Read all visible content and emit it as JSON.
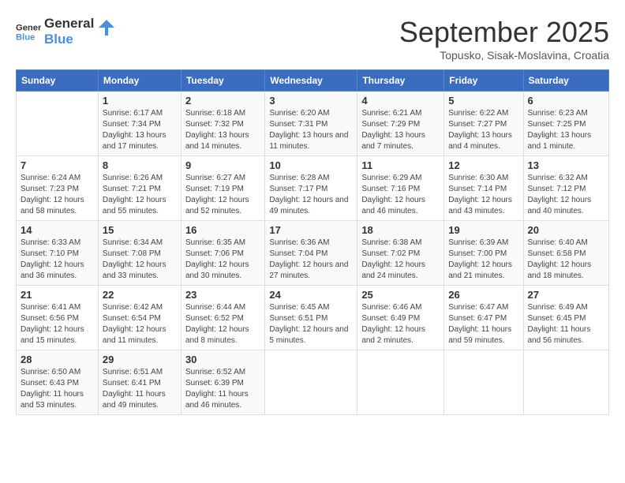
{
  "header": {
    "logo_line1": "General",
    "logo_line2": "Blue",
    "month_title": "September 2025",
    "subtitle": "Topusko, Sisak-Moslavina, Croatia"
  },
  "weekdays": [
    "Sunday",
    "Monday",
    "Tuesday",
    "Wednesday",
    "Thursday",
    "Friday",
    "Saturday"
  ],
  "weeks": [
    [
      {
        "day": "",
        "sunrise": "",
        "sunset": "",
        "daylight": ""
      },
      {
        "day": "1",
        "sunrise": "Sunrise: 6:17 AM",
        "sunset": "Sunset: 7:34 PM",
        "daylight": "Daylight: 13 hours and 17 minutes."
      },
      {
        "day": "2",
        "sunrise": "Sunrise: 6:18 AM",
        "sunset": "Sunset: 7:32 PM",
        "daylight": "Daylight: 13 hours and 14 minutes."
      },
      {
        "day": "3",
        "sunrise": "Sunrise: 6:20 AM",
        "sunset": "Sunset: 7:31 PM",
        "daylight": "Daylight: 13 hours and 11 minutes."
      },
      {
        "day": "4",
        "sunrise": "Sunrise: 6:21 AM",
        "sunset": "Sunset: 7:29 PM",
        "daylight": "Daylight: 13 hours and 7 minutes."
      },
      {
        "day": "5",
        "sunrise": "Sunrise: 6:22 AM",
        "sunset": "Sunset: 7:27 PM",
        "daylight": "Daylight: 13 hours and 4 minutes."
      },
      {
        "day": "6",
        "sunrise": "Sunrise: 6:23 AM",
        "sunset": "Sunset: 7:25 PM",
        "daylight": "Daylight: 13 hours and 1 minute."
      }
    ],
    [
      {
        "day": "7",
        "sunrise": "Sunrise: 6:24 AM",
        "sunset": "Sunset: 7:23 PM",
        "daylight": "Daylight: 12 hours and 58 minutes."
      },
      {
        "day": "8",
        "sunrise": "Sunrise: 6:26 AM",
        "sunset": "Sunset: 7:21 PM",
        "daylight": "Daylight: 12 hours and 55 minutes."
      },
      {
        "day": "9",
        "sunrise": "Sunrise: 6:27 AM",
        "sunset": "Sunset: 7:19 PM",
        "daylight": "Daylight: 12 hours and 52 minutes."
      },
      {
        "day": "10",
        "sunrise": "Sunrise: 6:28 AM",
        "sunset": "Sunset: 7:17 PM",
        "daylight": "Daylight: 12 hours and 49 minutes."
      },
      {
        "day": "11",
        "sunrise": "Sunrise: 6:29 AM",
        "sunset": "Sunset: 7:16 PM",
        "daylight": "Daylight: 12 hours and 46 minutes."
      },
      {
        "day": "12",
        "sunrise": "Sunrise: 6:30 AM",
        "sunset": "Sunset: 7:14 PM",
        "daylight": "Daylight: 12 hours and 43 minutes."
      },
      {
        "day": "13",
        "sunrise": "Sunrise: 6:32 AM",
        "sunset": "Sunset: 7:12 PM",
        "daylight": "Daylight: 12 hours and 40 minutes."
      }
    ],
    [
      {
        "day": "14",
        "sunrise": "Sunrise: 6:33 AM",
        "sunset": "Sunset: 7:10 PM",
        "daylight": "Daylight: 12 hours and 36 minutes."
      },
      {
        "day": "15",
        "sunrise": "Sunrise: 6:34 AM",
        "sunset": "Sunset: 7:08 PM",
        "daylight": "Daylight: 12 hours and 33 minutes."
      },
      {
        "day": "16",
        "sunrise": "Sunrise: 6:35 AM",
        "sunset": "Sunset: 7:06 PM",
        "daylight": "Daylight: 12 hours and 30 minutes."
      },
      {
        "day": "17",
        "sunrise": "Sunrise: 6:36 AM",
        "sunset": "Sunset: 7:04 PM",
        "daylight": "Daylight: 12 hours and 27 minutes."
      },
      {
        "day": "18",
        "sunrise": "Sunrise: 6:38 AM",
        "sunset": "Sunset: 7:02 PM",
        "daylight": "Daylight: 12 hours and 24 minutes."
      },
      {
        "day": "19",
        "sunrise": "Sunrise: 6:39 AM",
        "sunset": "Sunset: 7:00 PM",
        "daylight": "Daylight: 12 hours and 21 minutes."
      },
      {
        "day": "20",
        "sunrise": "Sunrise: 6:40 AM",
        "sunset": "Sunset: 6:58 PM",
        "daylight": "Daylight: 12 hours and 18 minutes."
      }
    ],
    [
      {
        "day": "21",
        "sunrise": "Sunrise: 6:41 AM",
        "sunset": "Sunset: 6:56 PM",
        "daylight": "Daylight: 12 hours and 15 minutes."
      },
      {
        "day": "22",
        "sunrise": "Sunrise: 6:42 AM",
        "sunset": "Sunset: 6:54 PM",
        "daylight": "Daylight: 12 hours and 11 minutes."
      },
      {
        "day": "23",
        "sunrise": "Sunrise: 6:44 AM",
        "sunset": "Sunset: 6:52 PM",
        "daylight": "Daylight: 12 hours and 8 minutes."
      },
      {
        "day": "24",
        "sunrise": "Sunrise: 6:45 AM",
        "sunset": "Sunset: 6:51 PM",
        "daylight": "Daylight: 12 hours and 5 minutes."
      },
      {
        "day": "25",
        "sunrise": "Sunrise: 6:46 AM",
        "sunset": "Sunset: 6:49 PM",
        "daylight": "Daylight: 12 hours and 2 minutes."
      },
      {
        "day": "26",
        "sunrise": "Sunrise: 6:47 AM",
        "sunset": "Sunset: 6:47 PM",
        "daylight": "Daylight: 11 hours and 59 minutes."
      },
      {
        "day": "27",
        "sunrise": "Sunrise: 6:49 AM",
        "sunset": "Sunset: 6:45 PM",
        "daylight": "Daylight: 11 hours and 56 minutes."
      }
    ],
    [
      {
        "day": "28",
        "sunrise": "Sunrise: 6:50 AM",
        "sunset": "Sunset: 6:43 PM",
        "daylight": "Daylight: 11 hours and 53 minutes."
      },
      {
        "day": "29",
        "sunrise": "Sunrise: 6:51 AM",
        "sunset": "Sunset: 6:41 PM",
        "daylight": "Daylight: 11 hours and 49 minutes."
      },
      {
        "day": "30",
        "sunrise": "Sunrise: 6:52 AM",
        "sunset": "Sunset: 6:39 PM",
        "daylight": "Daylight: 11 hours and 46 minutes."
      },
      {
        "day": "",
        "sunrise": "",
        "sunset": "",
        "daylight": ""
      },
      {
        "day": "",
        "sunrise": "",
        "sunset": "",
        "daylight": ""
      },
      {
        "day": "",
        "sunrise": "",
        "sunset": "",
        "daylight": ""
      },
      {
        "day": "",
        "sunrise": "",
        "sunset": "",
        "daylight": ""
      }
    ]
  ]
}
